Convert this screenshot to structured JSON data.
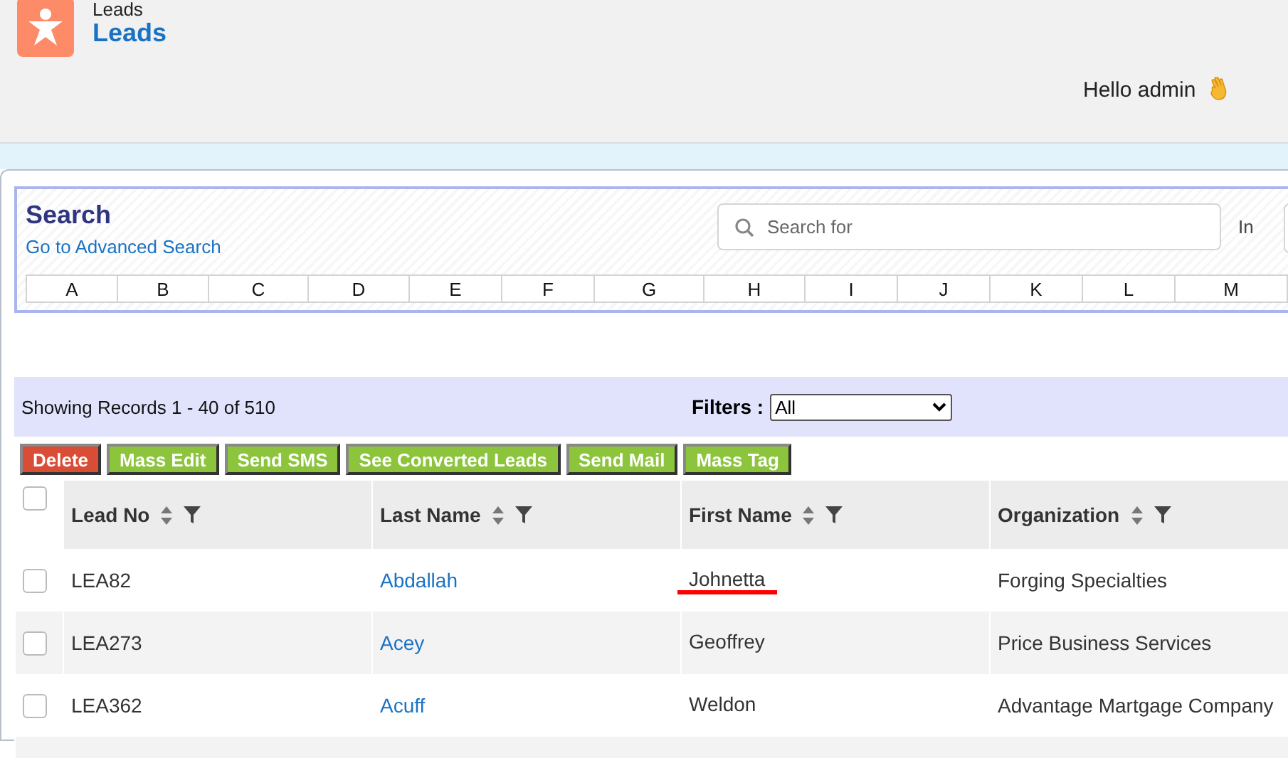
{
  "header": {
    "breadcrumb": "Leads",
    "title": "Leads",
    "greeting": "Hello admin"
  },
  "search": {
    "title": "Search",
    "advanced_link": "Go to Advanced Search",
    "placeholder": "Search for",
    "in_label": "In",
    "letters": [
      "A",
      "B",
      "C",
      "D",
      "E",
      "F",
      "G",
      "H",
      "I",
      "J",
      "K",
      "L",
      "M"
    ]
  },
  "records": {
    "summary": "Showing Records 1 - 40 of 510",
    "filters_label": "Filters :",
    "filter_value": "All"
  },
  "actions": [
    {
      "label": "Delete",
      "kind": "danger"
    },
    {
      "label": "Mass Edit",
      "kind": "normal"
    },
    {
      "label": "Send SMS",
      "kind": "normal"
    },
    {
      "label": "See Converted Leads",
      "kind": "normal"
    },
    {
      "label": "Send Mail",
      "kind": "normal"
    },
    {
      "label": "Mass Tag",
      "kind": "normal"
    }
  ],
  "table": {
    "select_all_checked": false,
    "columns": [
      "Lead No",
      "Last Name",
      "First Name",
      "Organization"
    ],
    "rows": [
      {
        "checked": false,
        "lead_no": "LEA82",
        "last_name": "Abdallah",
        "first_name": "Johnetta",
        "organization": "Forging Specialties",
        "underlined": true
      },
      {
        "checked": false,
        "lead_no": "LEA273",
        "last_name": "Acey",
        "first_name": "Geoffrey",
        "organization": "Price Business Services",
        "underlined": false
      },
      {
        "checked": false,
        "lead_no": "LEA362",
        "last_name": "Acuff",
        "first_name": "Weldon",
        "organization": "Advantage Martgage Company",
        "underlined": false
      }
    ]
  }
}
